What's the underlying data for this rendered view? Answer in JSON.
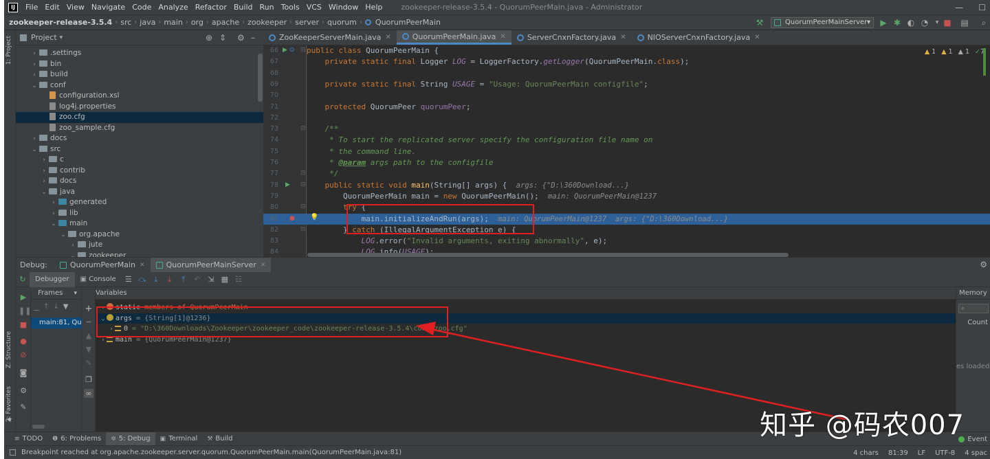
{
  "menubar": {
    "items": [
      "File",
      "Edit",
      "View",
      "Navigate",
      "Code",
      "Analyze",
      "Refactor",
      "Build",
      "Run",
      "Tools",
      "VCS",
      "Window",
      "Help"
    ],
    "window_title": "zookeeper-release-3.5.4 - QuorumPeerMain.java - Administrator"
  },
  "navbar": {
    "crumbs": [
      "zookeeper-release-3.5.4",
      "src",
      "java",
      "main",
      "org",
      "apache",
      "zookeeper",
      "server",
      "quorum",
      "QuorumPeerMain"
    ],
    "run_config": "QuorumPeerMainServer"
  },
  "sidebar_tabs": {
    "project": "1: Project",
    "structure": "Z: Structure",
    "favorites": "2: Favorites"
  },
  "project": {
    "title": "Project",
    "tree": [
      {
        "label": ".settings",
        "depth": 1,
        "kind": "folder",
        "expanded": false
      },
      {
        "label": "bin",
        "depth": 1,
        "kind": "folder",
        "expanded": false
      },
      {
        "label": "build",
        "depth": 1,
        "kind": "folder",
        "expanded": false
      },
      {
        "label": "conf",
        "depth": 1,
        "kind": "folder",
        "expanded": true
      },
      {
        "label": "configuration.xsl",
        "depth": 2,
        "kind": "xml"
      },
      {
        "label": "log4j.properties",
        "depth": 2,
        "kind": "file"
      },
      {
        "label": "zoo.cfg",
        "depth": 2,
        "kind": "file",
        "selected": true
      },
      {
        "label": "zoo_sample.cfg",
        "depth": 2,
        "kind": "file"
      },
      {
        "label": "docs",
        "depth": 1,
        "kind": "folder",
        "expanded": false
      },
      {
        "label": "src",
        "depth": 1,
        "kind": "folder",
        "expanded": true
      },
      {
        "label": "c",
        "depth": 2,
        "kind": "folder",
        "expanded": false
      },
      {
        "label": "contrib",
        "depth": 2,
        "kind": "folder",
        "expanded": false
      },
      {
        "label": "docs",
        "depth": 2,
        "kind": "folder",
        "expanded": false
      },
      {
        "label": "java",
        "depth": 2,
        "kind": "folder",
        "expanded": true
      },
      {
        "label": "generated",
        "depth": 3,
        "kind": "bfolder",
        "expanded": false
      },
      {
        "label": "lib",
        "depth": 3,
        "kind": "folder",
        "expanded": false
      },
      {
        "label": "main",
        "depth": 3,
        "kind": "bfolder",
        "expanded": true
      },
      {
        "label": "org.apache",
        "depth": 4,
        "kind": "folder",
        "expanded": true
      },
      {
        "label": "jute",
        "depth": 5,
        "kind": "folder",
        "expanded": false
      },
      {
        "label": "zookeeper",
        "depth": 5,
        "kind": "folder",
        "expanded": true
      }
    ]
  },
  "editor": {
    "tabs": [
      {
        "label": "ZooKeeperServerMain.java",
        "active": false
      },
      {
        "label": "QuorumPeerMain.java",
        "active": true
      },
      {
        "label": "ServerCnxnFactory.java",
        "active": false
      },
      {
        "label": "NIOServerCnxnFactory.java",
        "active": false
      }
    ],
    "inspections": {
      "warn1": "1",
      "warn2": "1",
      "warn3": "1",
      "ok": "7"
    },
    "lines": [
      {
        "n": "66",
        "segs": [
          [
            "kw",
            "public class "
          ],
          [
            "cls",
            "QuorumPeerMain {"
          ]
        ]
      },
      {
        "n": "67",
        "segs": [
          [
            "kw",
            "    private static final "
          ],
          [
            "cls",
            "Logger "
          ],
          [
            "fld",
            "LOG"
          ],
          [
            "cls",
            " = LoggerFactory."
          ],
          [
            "fld",
            "getLogger"
          ],
          [
            "cls",
            "(QuorumPeerMain."
          ],
          [
            "kw",
            "class"
          ],
          [
            "cls",
            ");"
          ]
        ]
      },
      {
        "n": "68",
        "segs": []
      },
      {
        "n": "69",
        "segs": [
          [
            "kw",
            "    private static final "
          ],
          [
            "cls",
            "String "
          ],
          [
            "fld",
            "USAGE"
          ],
          [
            "cls",
            " = "
          ],
          [
            "str",
            "\"Usage: QuorumPeerMain configfile\""
          ],
          [
            "cls",
            ";"
          ]
        ]
      },
      {
        "n": "70",
        "segs": []
      },
      {
        "n": "71",
        "segs": [
          [
            "kw",
            "    protected "
          ],
          [
            "cls",
            "QuorumPeer "
          ],
          [
            "fld2",
            "quorumPeer"
          ],
          [
            "cls",
            ";"
          ]
        ]
      },
      {
        "n": "72",
        "segs": []
      },
      {
        "n": "73",
        "segs": [
          [
            "cmt",
            "    /**"
          ]
        ]
      },
      {
        "n": "74",
        "segs": [
          [
            "cmt",
            "     * To start the replicated server specify the configuration file name on"
          ]
        ]
      },
      {
        "n": "75",
        "segs": [
          [
            "cmt",
            "     * the command line."
          ]
        ]
      },
      {
        "n": "76",
        "segs": [
          [
            "cmt",
            "     * "
          ],
          [
            "tag",
            "@param"
          ],
          [
            "cmt",
            " args path to the configfile"
          ]
        ]
      },
      {
        "n": "77",
        "segs": [
          [
            "cmt",
            "     */"
          ]
        ]
      },
      {
        "n": "78",
        "segs": [
          [
            "kw",
            "    public static void "
          ],
          [
            "meth",
            "main"
          ],
          [
            "cls",
            "(String[] args) {  "
          ],
          [
            "hint",
            "args: {\"D:\\360Download...}"
          ]
        ]
      },
      {
        "n": "79",
        "segs": [
          [
            "cls",
            "        QuorumPeerMain main = "
          ],
          [
            "kw",
            "new "
          ],
          [
            "cls",
            "QuorumPeerMain();  "
          ],
          [
            "hint",
            "main: QuorumPeerMain@1237"
          ]
        ]
      },
      {
        "n": "80",
        "segs": [
          [
            "kw",
            "        try "
          ],
          [
            "cls",
            "{"
          ]
        ]
      },
      {
        "n": "81",
        "segs": [
          [
            "cls",
            "            main.initializeAndRun(args);  "
          ],
          [
            "hint",
            "main: QuorumPeerMain@1237  args: {\"D:\\360Download...}"
          ]
        ],
        "current": true
      },
      {
        "n": "82",
        "segs": [
          [
            "cls",
            "        } "
          ],
          [
            "kw",
            "catch "
          ],
          [
            "cls",
            "(IllegalArgumentException e) {"
          ]
        ]
      },
      {
        "n": "83",
        "segs": [
          [
            "fld",
            "            LOG"
          ],
          [
            "cls",
            "."
          ],
          [
            "cls",
            "error("
          ],
          [
            "str",
            "\"Invalid arguments, exiting abnormally\""
          ],
          [
            "cls",
            ", e);"
          ]
        ]
      },
      {
        "n": "84",
        "segs": [
          [
            "fld",
            "            LOG"
          ],
          [
            "cls",
            ".info("
          ],
          [
            "fld",
            "USAGE"
          ],
          [
            "cls",
            ");"
          ]
        ]
      }
    ]
  },
  "debug": {
    "label": "Debug:",
    "tabs": [
      {
        "label": "QuorumPeerMain",
        "active": false
      },
      {
        "label": "QuorumPeerMainServer",
        "active": true
      }
    ],
    "tool_tabs": {
      "debugger": "Debugger",
      "console": "Console"
    },
    "frames_title": "Frames",
    "frame_selected": "main:81, Quo",
    "variables_title": "Variables",
    "variables": [
      {
        "kind": "static",
        "name": "static",
        "value": " members of QuorumPeerMain",
        "expanded": false
      },
      {
        "kind": "param",
        "name": "args",
        "value": " = {String[1]@1236}",
        "expanded": true,
        "selected": true
      },
      {
        "kind": "elem",
        "name": "0",
        "value": " = \"D:\\360Downloads\\Zookeeper\\zookeeper_code\\zookeeper-release-3.5.4\\conf\\zoo.cfg\"",
        "child": true
      },
      {
        "kind": "local",
        "name": "main",
        "value": " = {QuorumPeerMain@1237}",
        "expanded": false
      }
    ],
    "memory": {
      "title": "Memory",
      "count": "Count",
      "loaded": "es loaded."
    }
  },
  "bottom_tabs": [
    {
      "label": "TODO",
      "icon": "≡"
    },
    {
      "label": "6: Problems",
      "icon": "❶"
    },
    {
      "label": "5: Debug",
      "icon": "✲",
      "active": true
    },
    {
      "label": "Terminal",
      "icon": "▣"
    },
    {
      "label": "Build",
      "icon": "⚒"
    }
  ],
  "event_log": "Event",
  "status": {
    "message": "Breakpoint reached at org.apache.zookeeper.server.quorum.QuorumPeerMain.main(QuorumPeerMain.java:81)",
    "chars": "4 chars",
    "position": "81:39",
    "line_sep": "LF",
    "encoding": "UTF-8",
    "indent": "4 spac"
  },
  "watermark": "知乎 @码农007",
  "colors": {
    "accent": "#4a88c7",
    "annotation": "#e02020",
    "current_line": "#2d6099"
  }
}
